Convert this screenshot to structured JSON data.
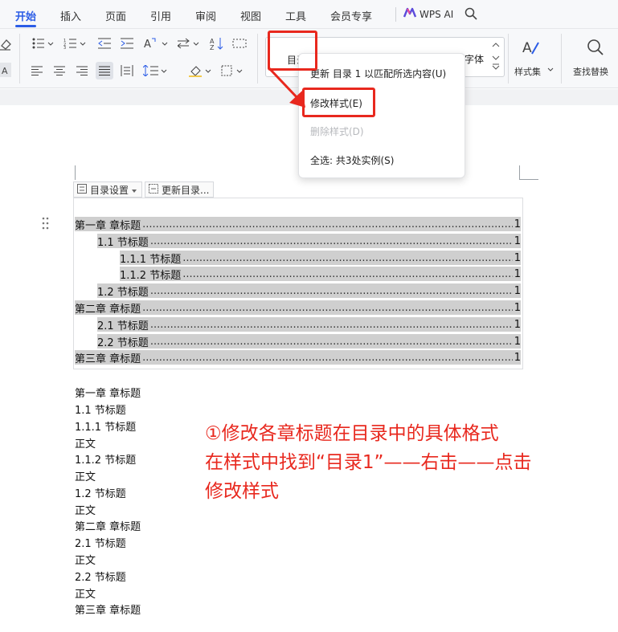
{
  "menu": {
    "tabs": [
      {
        "label": "开始"
      },
      {
        "label": "插入"
      },
      {
        "label": "页面"
      },
      {
        "label": "引用"
      },
      {
        "label": "审阅"
      },
      {
        "label": "视图"
      },
      {
        "label": "工具"
      },
      {
        "label": "会员专享"
      }
    ],
    "wps_ai": "WPS AI"
  },
  "ribbon": {
    "style_gallery_current": "目录",
    "style_font_partial": "字体",
    "style_set_label": "样式集",
    "find_replace_label": "查找替换"
  },
  "context_menu": {
    "items": [
      {
        "label": "更新 目录 1 以匹配所选内容(U)",
        "enabled": true
      },
      {
        "label": "修改样式(E)",
        "enabled": true
      },
      {
        "label": "删除样式(D)",
        "enabled": false
      },
      {
        "label": "全选: 共3处实例(S)",
        "enabled": true
      }
    ]
  },
  "toc_toolbar": {
    "settings_label": "目录设置",
    "update_label": "更新目录..."
  },
  "toc": [
    {
      "text": "第一章  章标题",
      "page": "1",
      "level": 1
    },
    {
      "text": "1.1  节标题",
      "page": "1",
      "level": 2
    },
    {
      "text": "1.1.1  节标题",
      "page": "1",
      "level": 3
    },
    {
      "text": "1.1.2  节标题",
      "page": "1",
      "level": 3
    },
    {
      "text": "1.2  节标题",
      "page": "1",
      "level": 2
    },
    {
      "text": "第二章  章标题",
      "page": "1",
      "level": 1
    },
    {
      "text": "2.1  节标题",
      "page": "1",
      "level": 2
    },
    {
      "text": "2.2  节标题",
      "page": "1",
      "level": 2
    },
    {
      "text": "第三章  章标题",
      "page": "1",
      "level": 1
    }
  ],
  "body_lines": [
    "第一章  章标题",
    "1.1  节标题",
    "1.1.1  节标题",
    "正文",
    "1.1.2  节标题",
    "正文",
    "1.2  节标题",
    "正文",
    "第二章  章标题",
    "2.1  节标题",
    "正文",
    "2.2  节标题",
    "正文",
    "第三章  章标题"
  ],
  "annotation": {
    "line1": "①修改各章标题在目录中的具体格式",
    "line2": "在样式中找到“目录1”——右击——点击",
    "line3": "修改样式"
  },
  "colors": {
    "accent": "#2b5ce6",
    "annotation_red": "#e8281e",
    "toc_highlight": "#cfcfcf"
  }
}
